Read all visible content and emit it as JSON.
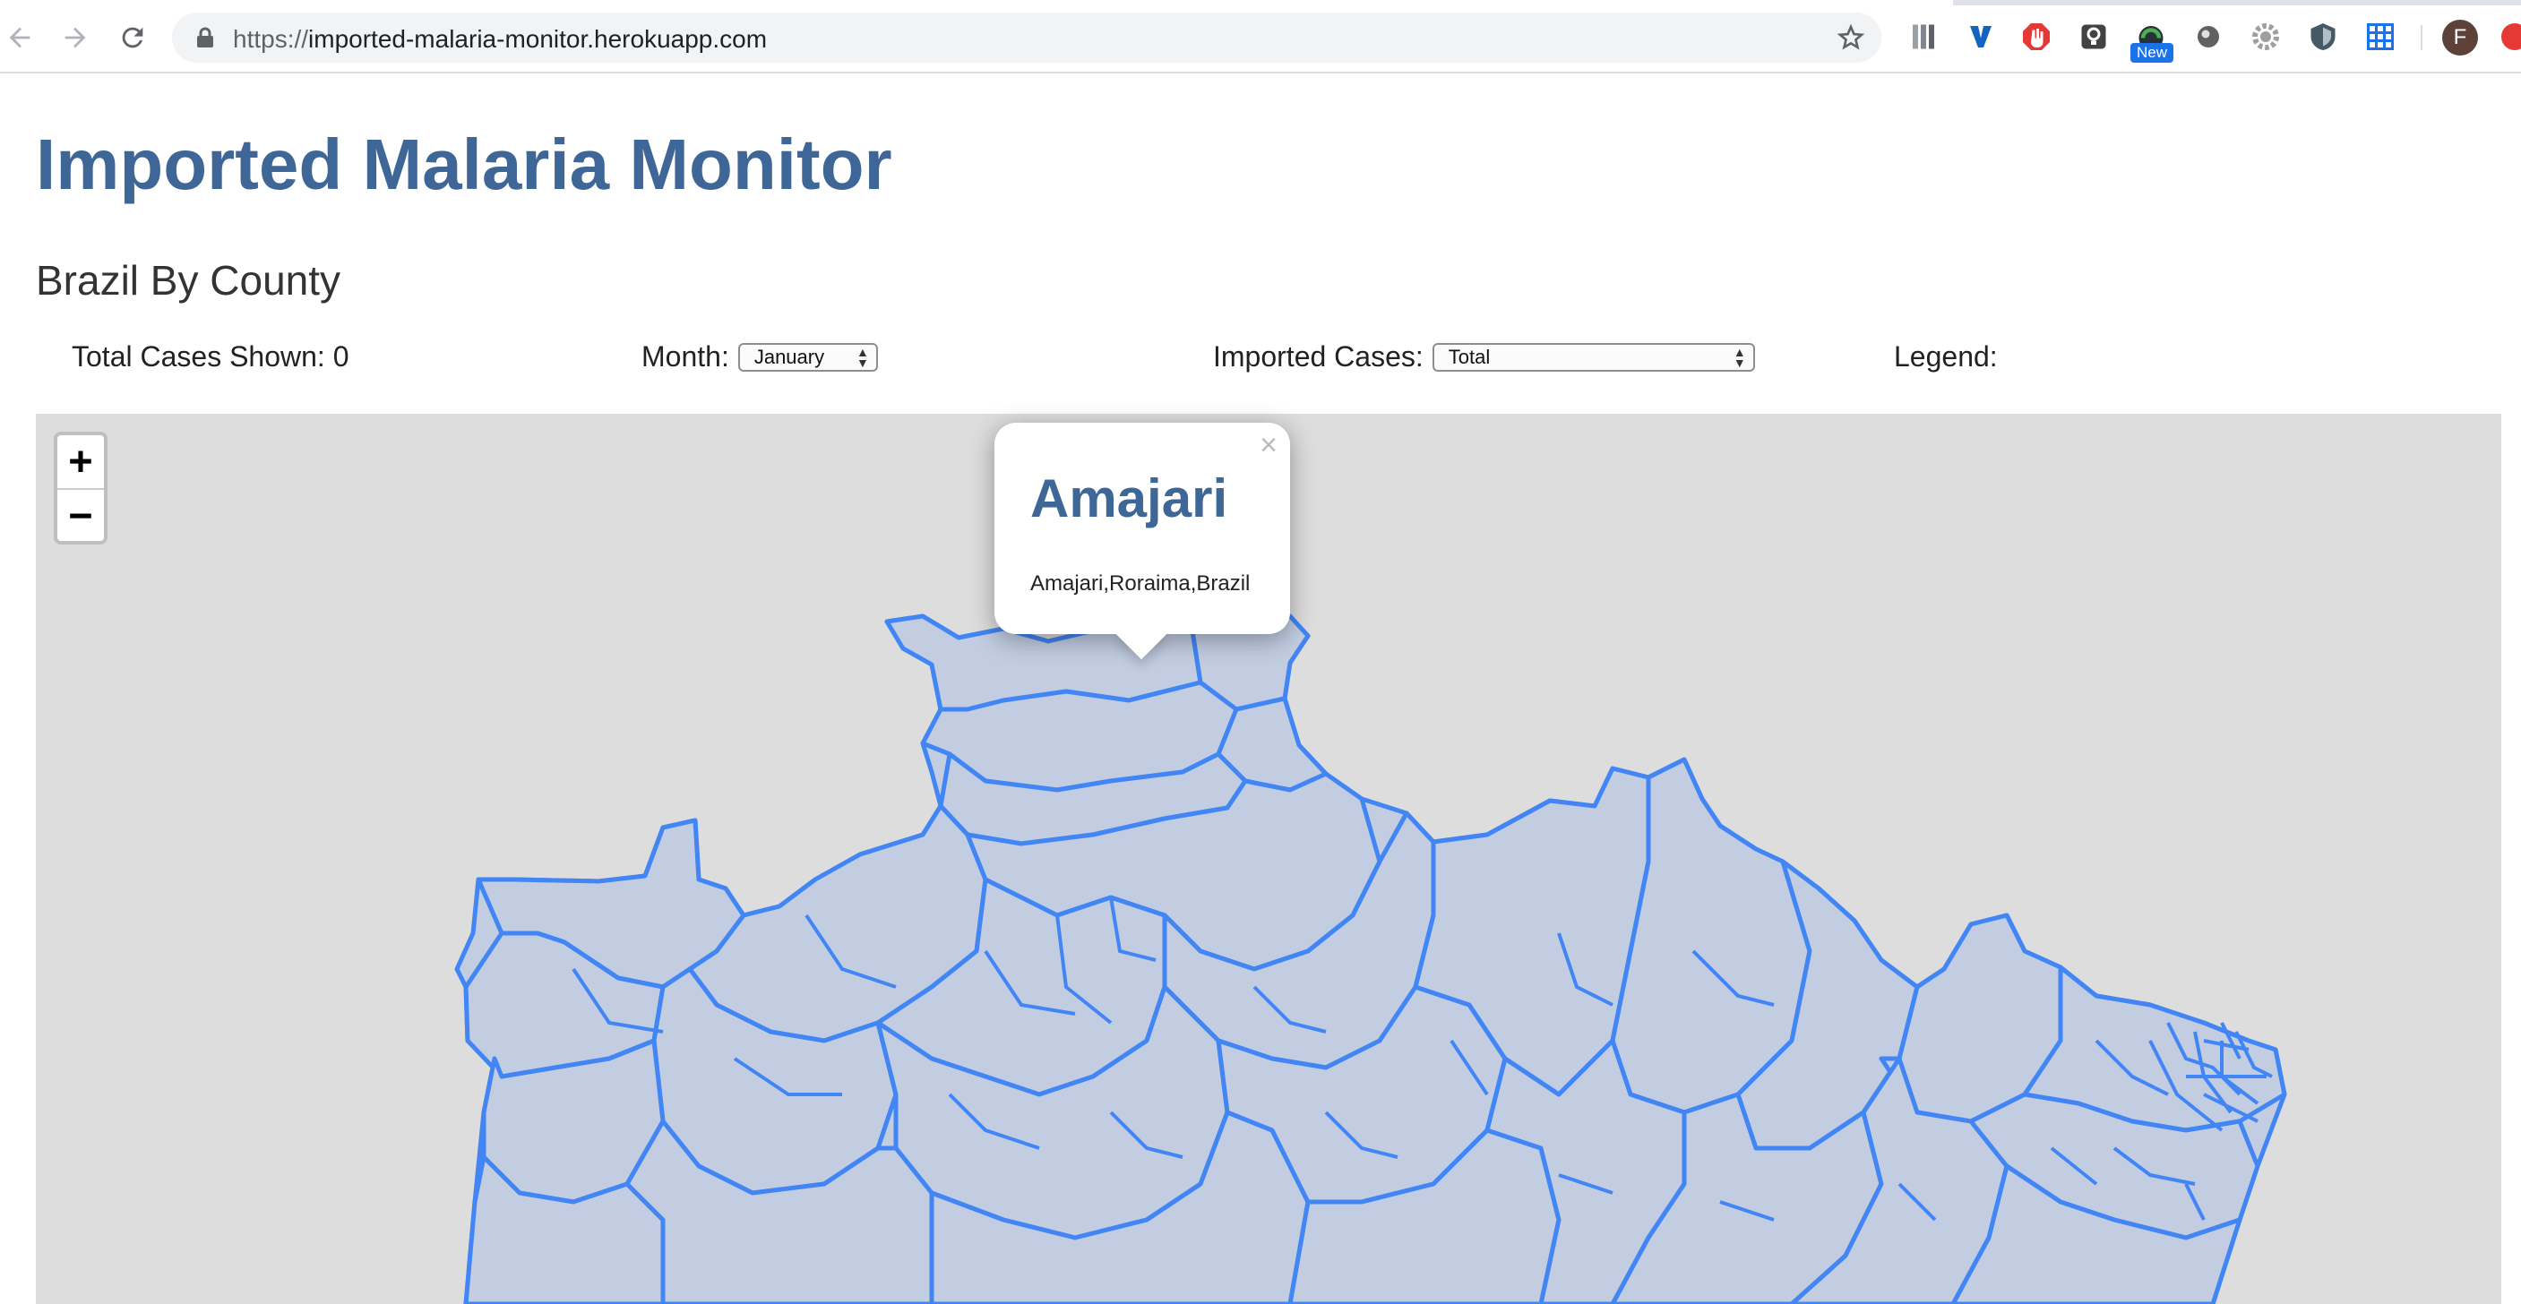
{
  "browser": {
    "url_scheme": "https://",
    "url_host": "imported-malaria-monitor.herokuapp.com",
    "new_badge": "New",
    "profile_initial": "F",
    "extensions": [
      "bookmarks-bar-icon",
      "vimium-icon",
      "adblock-icon",
      "lightbulb-icon",
      "speedometer-icon",
      "circle-extension-icon",
      "gear-extension-icon",
      "shield-extension-icon",
      "grid-extension-icon"
    ]
  },
  "page": {
    "title": "Imported Malaria Monitor",
    "subtitle": "Brazil By County"
  },
  "controls": {
    "total_cases_label": "Total Cases Shown: 0",
    "month_label": "Month:",
    "month_value": "January",
    "imported_label": "Imported Cases:",
    "imported_value": "Total",
    "legend_label": "Legend:"
  },
  "map": {
    "zoom_in": "+",
    "zoom_out": "−",
    "background_color": "#dddddd",
    "region_fill": "#c2cde2",
    "region_stroke": "#4285f4",
    "popup": {
      "close": "×",
      "title": "Amajari",
      "body": "Amajari,Roraima,Brazil"
    }
  },
  "colors": {
    "title": "#3e6696",
    "text": "#333333"
  }
}
